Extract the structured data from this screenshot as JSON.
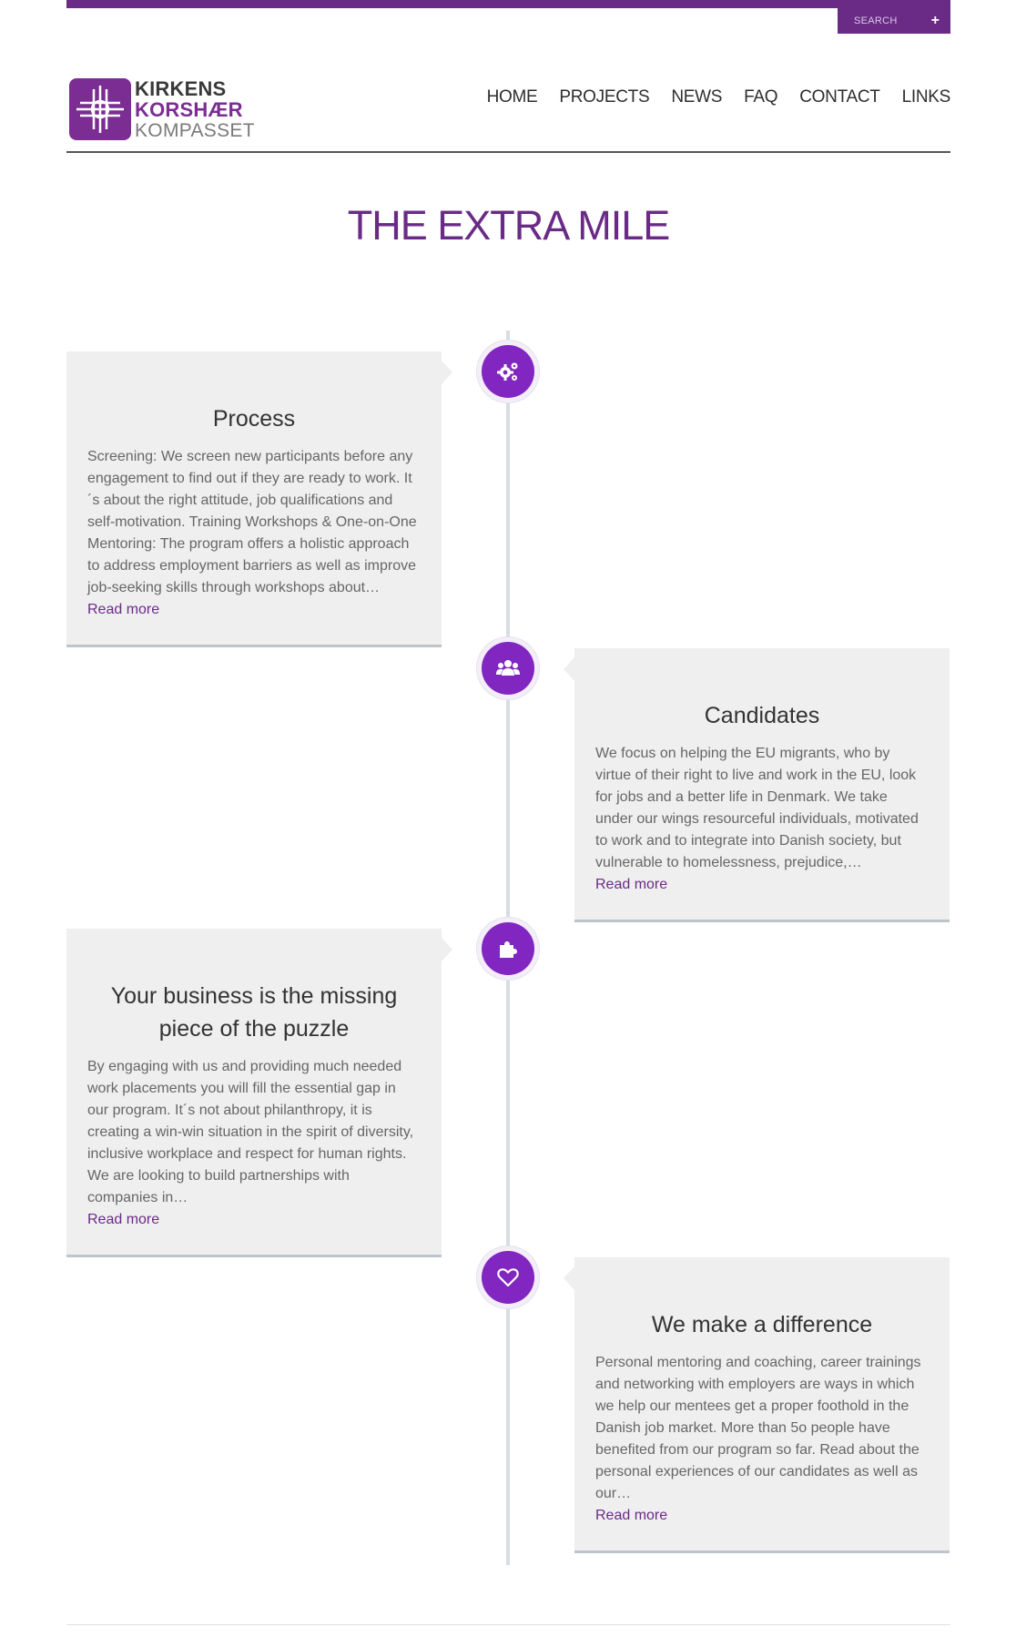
{
  "header": {
    "search_label": "SEARCH",
    "search_plus": "+",
    "logo": {
      "line1": "KIRKENS",
      "line2": "KORSHÆR",
      "line3": "KOMPASSET"
    },
    "nav": [
      "HOME",
      "PROJECTS",
      "NEWS",
      "FAQ",
      "CONTACT",
      "LINKS"
    ]
  },
  "page": {
    "title": "THE EXTRA MILE"
  },
  "timeline": [
    {
      "icon": "gears-icon",
      "title": "Process",
      "body": "Screening: We screen new participants before any engagement to find out if they are ready to work. It´s about the right attitude, job qualifications and self-motivation. Training Workshops & One-on-One Mentoring: The program offers a holistic approach to address employment barriers as well as improve job-seeking skills through workshops about…",
      "link": "Read more"
    },
    {
      "icon": "group-icon",
      "title": "Candidates",
      "body": "We focus on helping the EU migrants, who by virtue of their right to live and work in the EU, look for jobs and a better life in Denmark. We take under our wings resourceful individuals, motivated to work and to integrate into Danish society, but vulnerable to homelessness, prejudice,…",
      "link": "Read more"
    },
    {
      "icon": "puzzle-icon",
      "title": "Your business is the missing piece of the puzzle",
      "body": "By engaging with us and providing much needed work placements you will fill the essential gap in our program. It´s not about philanthropy, it is creating a win-win situation in the spirit of diversity, inclusive workplace and respect for human rights. We are looking to build partnerships with companies in…",
      "link": "Read more"
    },
    {
      "icon": "heart-icon",
      "title": "We make a difference",
      "body": "Personal mentoring and coaching, career trainings and networking with employers are ways in which we help our mentees get a proper foothold in the Danish job market. More than 5o people have benefited from our program so far. Read about the personal experiences of our candidates as well as our…",
      "link": "Read more"
    }
  ],
  "colors": {
    "brand_purple": "#6a2b86",
    "icon_purple": "#8126c0",
    "card_bg": "#efefef"
  }
}
